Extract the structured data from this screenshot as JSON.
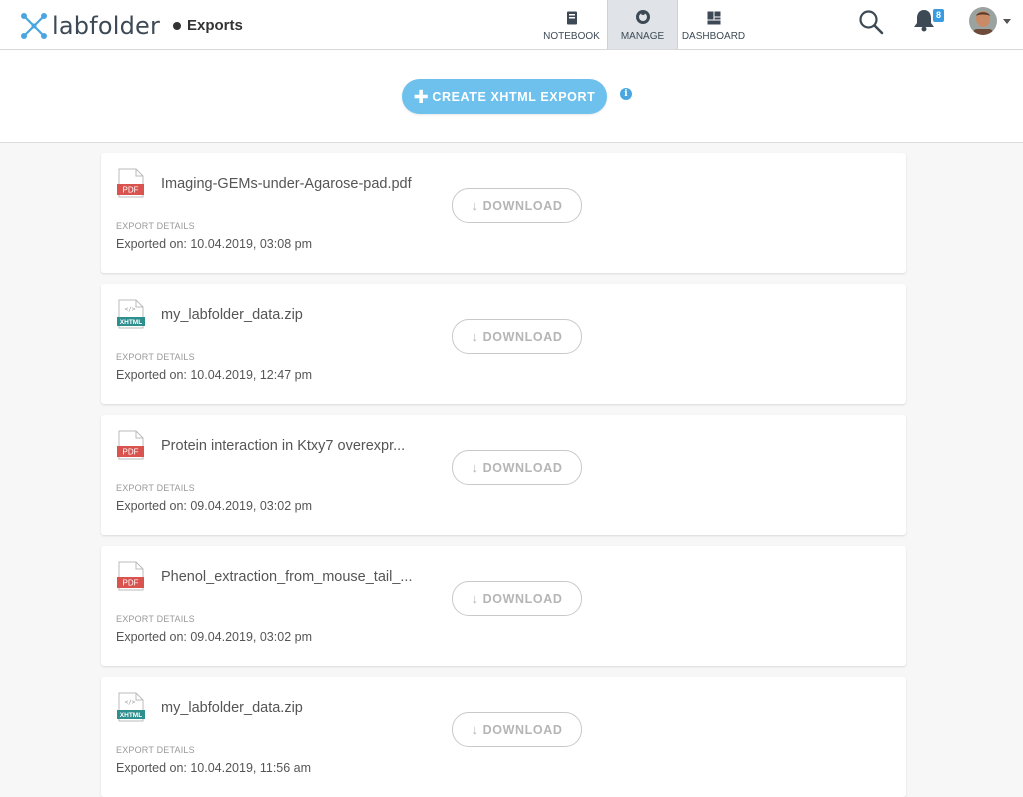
{
  "app": {
    "name": "labfolder",
    "section": "Exports"
  },
  "nav": [
    {
      "label": "NOTEBOOK",
      "icon": "notebook-icon",
      "active": false
    },
    {
      "label": "MANAGE",
      "icon": "manage-icon",
      "active": true
    },
    {
      "label": "DASHBOARD",
      "icon": "dashboard-icon",
      "active": false
    }
  ],
  "notifications": {
    "count": "8"
  },
  "create": {
    "label": "CREATE XHTML EXPORT"
  },
  "exports": [
    {
      "type": "PDF",
      "name": "Imaging-GEMs-under-Agarose-pad.pdf",
      "details_label": "EXPORT DETAILS",
      "exported": "Exported on: 10.04.2019, 03:08 pm",
      "download_label": "DOWNLOAD"
    },
    {
      "type": "XHTML",
      "name": "my_labfolder_data.zip",
      "details_label": "EXPORT DETAILS",
      "exported": "Exported on: 10.04.2019, 12:47 pm",
      "download_label": "DOWNLOAD"
    },
    {
      "type": "PDF",
      "name": "Protein interaction in Ktxy7 overexpr...",
      "details_label": "EXPORT DETAILS",
      "exported": "Exported on: 09.04.2019, 03:02 pm",
      "download_label": "DOWNLOAD"
    },
    {
      "type": "PDF",
      "name": "Phenol_extraction_from_mouse_tail_...",
      "details_label": "EXPORT DETAILS",
      "exported": "Exported on: 09.04.2019, 03:02 pm",
      "download_label": "DOWNLOAD"
    },
    {
      "type": "XHTML",
      "name": "my_labfolder_data.zip",
      "details_label": "EXPORT DETAILS",
      "exported": "Exported on: 10.04.2019, 11:56 am",
      "download_label": "DOWNLOAD"
    }
  ],
  "colors": {
    "accent": "#6ec1ec",
    "pdf": "#d9534f",
    "xhtml": "#2f8f8f",
    "badge": "#3a9be0"
  }
}
